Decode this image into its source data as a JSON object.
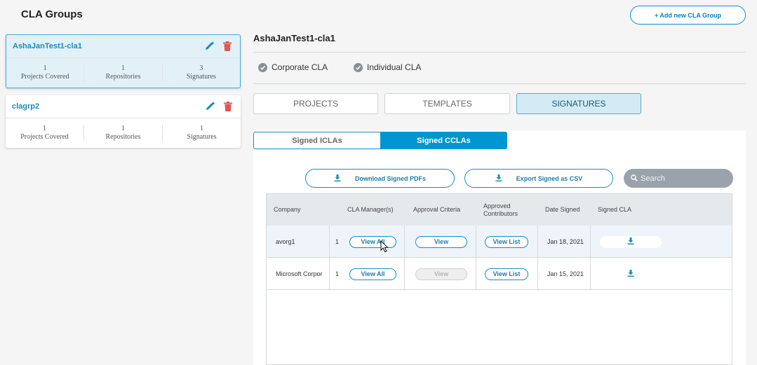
{
  "header": {
    "title": "CLA Groups",
    "add_button": "+ Add new CLA Group"
  },
  "groups": [
    {
      "name": "AshaJanTest1-cla1",
      "projects_value": "1",
      "projects_label": "Projects Covered",
      "repos_value": "1",
      "repos_label": "Repositories",
      "sigs_value": "3",
      "sigs_label": "Signatures"
    },
    {
      "name": "clagrp2",
      "projects_value": "1",
      "projects_label": "Projects Covered",
      "repos_value": "1",
      "repos_label": "Repositories",
      "sigs_value": "1",
      "sigs_label": "Signatures"
    }
  ],
  "detail": {
    "title": "AshaJanTest1-cla1",
    "cla_types": [
      "Corporate CLA",
      "Individual CLA"
    ],
    "tabs": [
      "PROJECTS",
      "TEMPLATES",
      "SIGNATURES"
    ],
    "active_tab": "SIGNATURES",
    "subtabs": [
      "Signed ICLAs",
      "Signed CCLAs"
    ],
    "active_subtab": "Signed CCLAs"
  },
  "actions": {
    "download_pdfs": "Download Signed PDFs",
    "export_csv": "Export Signed as CSV"
  },
  "search": {
    "placeholder": "Search"
  },
  "table": {
    "headers": {
      "company": "Company",
      "cla_manager": "CLA Manager(s)",
      "approval": "Approval Criteria",
      "approved_1": "Approved",
      "approved_2": "Contributors",
      "date": "Date Signed",
      "signed": "Signed CLA"
    },
    "rows": [
      {
        "company": "avorg1",
        "manager_count": "1",
        "manager_btn": "View All",
        "approval_btn": "View",
        "approval_enabled": true,
        "contrib_btn": "View List",
        "date": "Jan 18, 2021"
      },
      {
        "company": "Microsoft Corpor",
        "manager_count": "1",
        "manager_btn": "View All",
        "approval_btn": "View",
        "approval_enabled": false,
        "contrib_btn": "View List",
        "date": "Jan 15, 2021"
      }
    ]
  },
  "colors": {
    "accent": "#0096d0",
    "delete": "#e05555",
    "active_card": "#e2f1f8"
  }
}
